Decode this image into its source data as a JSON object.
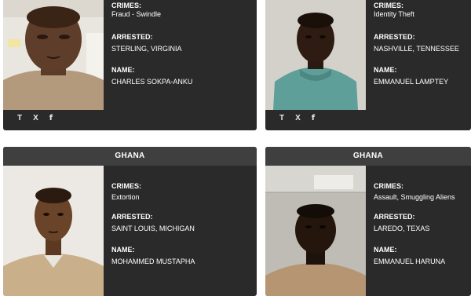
{
  "cards": [
    {
      "header": "",
      "crimes_label": "CRIMES:",
      "crimes": "Fraud - Swindle",
      "arrested_label": "ARRESTED:",
      "arrested": "STERLING, VIRGINIA",
      "name_label": "NAME:",
      "name": "CHARLES SOKPA-ANKU",
      "share": [
        "T",
        "X",
        "f"
      ]
    },
    {
      "header": "",
      "crimes_label": "CRIMES:",
      "crimes": "Identity Theft",
      "arrested_label": "ARRESTED:",
      "arrested": "NASHVILLE, TENNESSEE",
      "name_label": "NAME:",
      "name": "EMMANUEL LAMPTEY",
      "share": [
        "T",
        "X",
        "f"
      ]
    },
    {
      "header": "GHANA",
      "crimes_label": "CRIMES:",
      "crimes": "Extortion",
      "arrested_label": "ARRESTED:",
      "arrested": "SAINT LOUIS, MICHIGAN",
      "name_label": "NAME:",
      "name": "MOHAMMED MUSTAPHA"
    },
    {
      "header": "GHANA",
      "crimes_label": "CRIMES:",
      "crimes": "Assault, Smuggling Aliens",
      "arrested_label": "ARRESTED:",
      "arrested": "LAREDO, TEXAS",
      "name_label": "NAME:",
      "name": "EMMANUEL HARUNA"
    }
  ],
  "colors": {
    "card_bg": "#2a2a2a",
    "header_bg": "#3f3f3f",
    "text": "#ffffff"
  }
}
